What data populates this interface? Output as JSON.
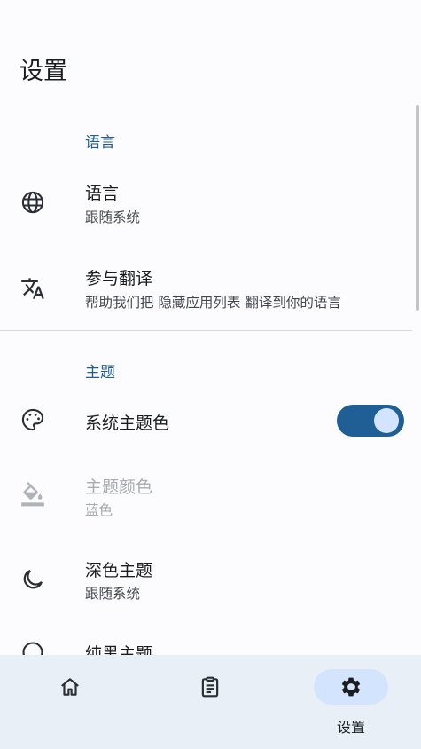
{
  "page": {
    "title": "设置"
  },
  "sections": {
    "language": {
      "header": "语言",
      "items": [
        {
          "label": "语言",
          "sub": "跟随系统",
          "icon": "globe-icon"
        },
        {
          "label": "参与翻译",
          "sub": "帮助我们把 隐藏应用列表 翻译到你的语言",
          "icon": "translate-icon"
        }
      ]
    },
    "theme": {
      "header": "主题",
      "items": [
        {
          "label": "系统主题色",
          "icon": "palette-icon",
          "switch_on": true
        },
        {
          "label": "主题颜色",
          "sub": "蓝色",
          "icon": "paint-bucket-icon",
          "disabled": true
        },
        {
          "label": "深色主题",
          "sub": "跟随系统",
          "icon": "moon-icon"
        },
        {
          "label": "纯黑主题",
          "icon": "contrast-icon"
        }
      ]
    }
  },
  "nav": {
    "items": [
      {
        "label": "",
        "icon": "home-icon"
      },
      {
        "label": "",
        "icon": "clipboard-list-icon"
      },
      {
        "label": "设置",
        "icon": "gear-icon",
        "active": true
      }
    ]
  },
  "colors": {
    "accent": "#1f5f95",
    "switch_knob": "#d3e4ff",
    "nav_bg": "#e8eff7"
  }
}
